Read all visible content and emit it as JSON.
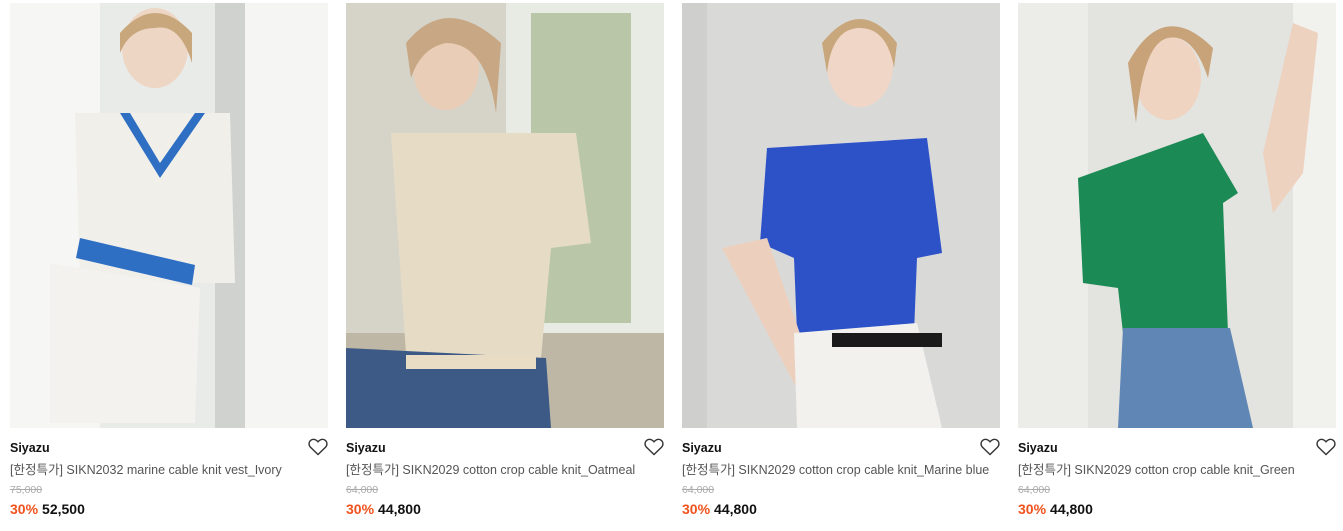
{
  "products": [
    {
      "brand": "Siyazu",
      "name": "[한정특가] SIKN2032 marine cable knit vest_Ivory",
      "original_price": "75,000",
      "discount": "30%",
      "price": "52,500",
      "colors": {
        "top": "#f1efe9",
        "accent": "#2e6fc4",
        "bottom": "#f4f2ee",
        "bg": "#e9ebe8"
      }
    },
    {
      "brand": "Siyazu",
      "name": "[한정특가] SIKN2029 cotton crop cable knit_Oatmeal",
      "original_price": "64,000",
      "discount": "30%",
      "price": "44,800",
      "colors": {
        "top": "#e6dcc6",
        "accent": "#e6dcc6",
        "bottom": "#3d5a86",
        "bg": "#d6d3c9"
      }
    },
    {
      "brand": "Siyazu",
      "name": "[한정특가] SIKN2029 cotton crop cable knit_Marine blue",
      "original_price": "64,000",
      "discount": "30%",
      "price": "44,800",
      "colors": {
        "top": "#2d52c8",
        "accent": "#2d52c8",
        "bottom": "#f2f1ee",
        "bg": "#d9dad8"
      }
    },
    {
      "brand": "Siyazu",
      "name": "[한정특가] SIKN2029 cotton crop cable knit_Green",
      "original_price": "64,000",
      "discount": "30%",
      "price": "44,800",
      "colors": {
        "top": "#1c8a55",
        "accent": "#1c8a55",
        "bottom": "#5f86b4",
        "bg": "#e3e3df"
      }
    }
  ]
}
